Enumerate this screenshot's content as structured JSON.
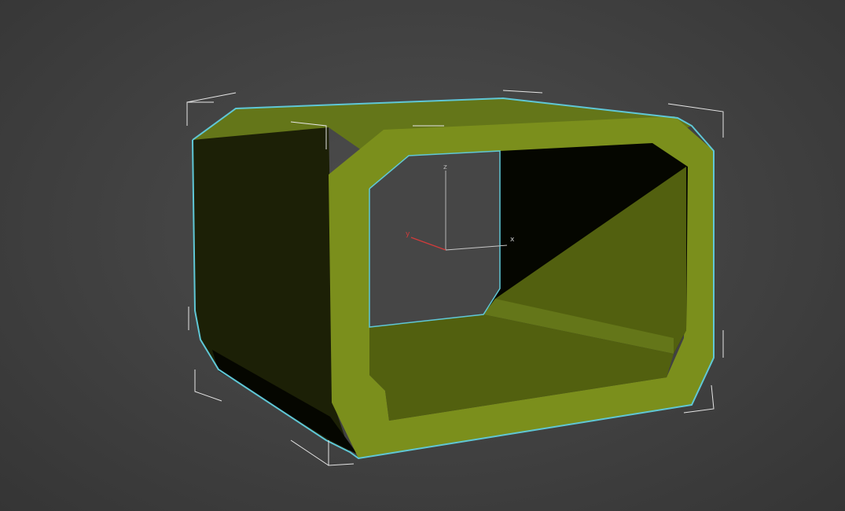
{
  "viewport": {
    "background_color": "#464646",
    "object": {
      "kind": "hollow-box-tube-with-chamfered-corners",
      "selected": true,
      "colors": {
        "face_lit": "#7b8f1c",
        "face_top": "#647619",
        "face_mid": "#52600f",
        "face_dark": "#1c2006",
        "inner_dark": "#050600",
        "selection_outline": "#5fc7d6",
        "bounding_box": "#e6e6e6"
      }
    },
    "gizmo": {
      "x_label": "x",
      "y_label": "y",
      "z_label": "z",
      "colors": {
        "x": "#c8c8c8",
        "y": "#d23b3b",
        "z": "#b4b4b4"
      }
    }
  }
}
